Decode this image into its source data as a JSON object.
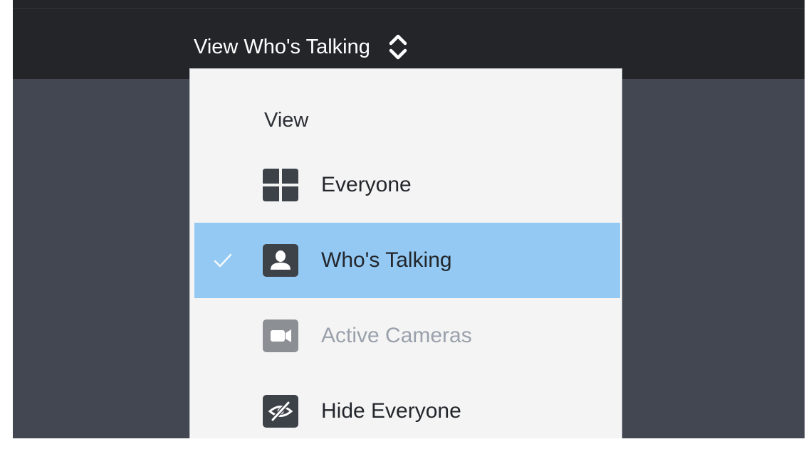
{
  "topbar": {
    "view_selector_label": "View Who's Talking",
    "view_selector_icon": "chevron-up-down-icon"
  },
  "view_menu": {
    "heading": "View",
    "items": [
      {
        "label": "Everyone",
        "icon": "grid-icon",
        "selected": false,
        "disabled": false
      },
      {
        "label": "Who's Talking",
        "icon": "person-icon",
        "selected": true,
        "disabled": false
      },
      {
        "label": "Active Cameras",
        "icon": "video-camera-icon",
        "selected": false,
        "disabled": true
      },
      {
        "label": "Hide Everyone",
        "icon": "eye-slash-icon",
        "selected": false,
        "disabled": false
      }
    ]
  },
  "colors": {
    "topbar_bg": "#232529",
    "content_bg": "#434751",
    "menu_bg": "#f4f4f4",
    "selected_bg": "#93c9f3",
    "disabled_text": "#9aa1ab"
  }
}
